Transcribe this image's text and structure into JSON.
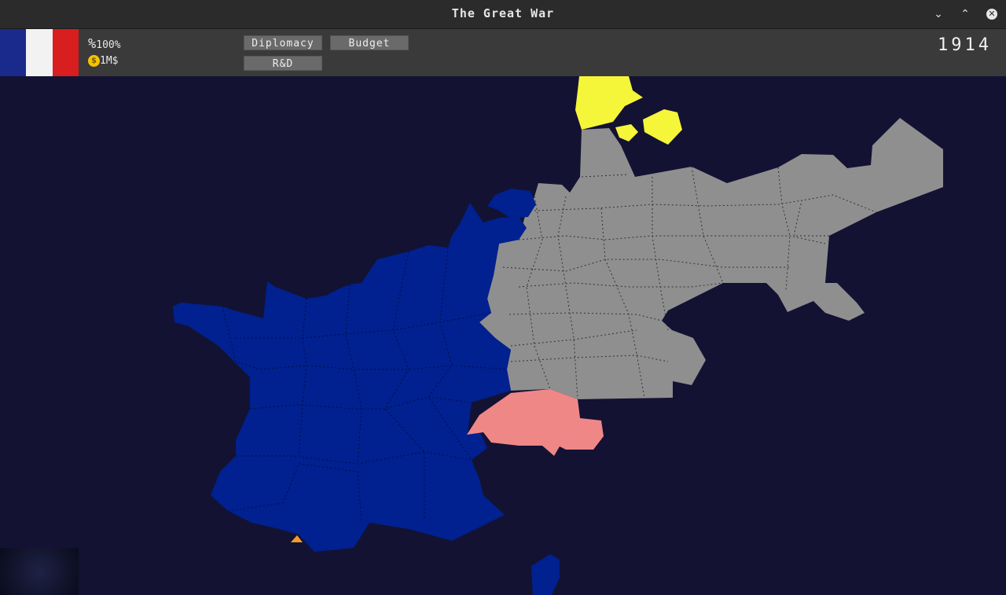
{
  "window": {
    "title": "The Great War"
  },
  "window_controls": [
    "minimize",
    "maximize",
    "close"
  ],
  "player": {
    "country_flag": {
      "colors": [
        "#1a2a8c",
        "#f2f2f2",
        "#d81e1e"
      ]
    },
    "stability_icon": "%",
    "stability_value": "100%",
    "money_value": "1M$"
  },
  "menu": {
    "diplomacy_label": "Diplomacy",
    "budget_label": "Budget",
    "rd_label": "R&D"
  },
  "year": "1914",
  "map": {
    "colors": {
      "sea": "#131233",
      "france": "#00218f",
      "germany": "#8f8f8f",
      "switzerland": "#ef8787",
      "denmark": "#f5f53a",
      "spain": "#f29a2e"
    }
  }
}
